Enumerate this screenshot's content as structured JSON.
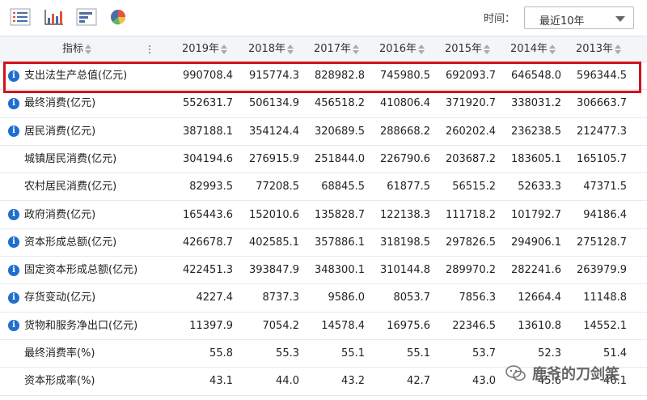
{
  "toolbar": {
    "icons": [
      "list-icon",
      "bar-chart-icon",
      "horizontal-bar-icon",
      "pie-chart-icon"
    ],
    "time_label": "时间：",
    "time_select": "最近10年"
  },
  "table": {
    "header_indicator": "指标",
    "years": [
      "2019年",
      "2018年",
      "2017年",
      "2016年",
      "2015年",
      "2014年",
      "2013年"
    ],
    "rows": [
      {
        "name": "支出法生产总值(亿元)",
        "icon": true,
        "values": [
          "990708.4",
          "915774.3",
          "828982.8",
          "745980.5",
          "692093.7",
          "646548.0",
          "596344.5"
        ]
      },
      {
        "name": "最终消费(亿元)",
        "icon": true,
        "values": [
          "552631.7",
          "506134.9",
          "456518.2",
          "410806.4",
          "371920.7",
          "338031.2",
          "306663.7"
        ]
      },
      {
        "name": "居民消费(亿元)",
        "icon": true,
        "values": [
          "387188.1",
          "354124.4",
          "320689.5",
          "288668.2",
          "260202.4",
          "236238.5",
          "212477.3"
        ]
      },
      {
        "name": "城镇居民消费(亿元)",
        "icon": false,
        "values": [
          "304194.6",
          "276915.9",
          "251844.0",
          "226790.6",
          "203687.2",
          "183605.1",
          "165105.7"
        ]
      },
      {
        "name": "农村居民消费(亿元)",
        "icon": false,
        "values": [
          "82993.5",
          "77208.5",
          "68845.5",
          "61877.5",
          "56515.2",
          "52633.3",
          "47371.5"
        ]
      },
      {
        "name": "政府消费(亿元)",
        "icon": true,
        "values": [
          "165443.6",
          "152010.6",
          "135828.7",
          "122138.3",
          "111718.2",
          "101792.7",
          "94186.4"
        ]
      },
      {
        "name": "资本形成总额(亿元)",
        "icon": true,
        "values": [
          "426678.7",
          "402585.1",
          "357886.1",
          "318198.5",
          "297826.5",
          "294906.1",
          "275128.7"
        ]
      },
      {
        "name": "固定资本形成总额(亿元)",
        "icon": true,
        "values": [
          "422451.3",
          "393847.9",
          "348300.1",
          "310144.8",
          "289970.2",
          "282241.6",
          "263979.9"
        ]
      },
      {
        "name": "存货变动(亿元)",
        "icon": true,
        "values": [
          "4227.4",
          "8737.3",
          "9586.0",
          "8053.7",
          "7856.3",
          "12664.4",
          "11148.8"
        ]
      },
      {
        "name": "货物和服务净出口(亿元)",
        "icon": true,
        "values": [
          "11397.9",
          "7054.2",
          "14578.4",
          "16975.6",
          "22346.5",
          "13610.8",
          "14552.1"
        ]
      },
      {
        "name": "最终消费率(%)",
        "icon": false,
        "values": [
          "55.8",
          "55.3",
          "55.1",
          "55.1",
          "53.7",
          "52.3",
          "51.4"
        ]
      },
      {
        "name": "资本形成率(%)",
        "icon": false,
        "values": [
          "43.1",
          "44.0",
          "43.2",
          "42.7",
          "43.0",
          "45.6",
          "46.1"
        ]
      }
    ]
  },
  "watermark": {
    "text": "鹿爷的刀剑笑"
  },
  "colors": {
    "highlight": "#d0131d",
    "info_icon": "#1e6fd0",
    "header_bg": "#f3f5f8"
  }
}
